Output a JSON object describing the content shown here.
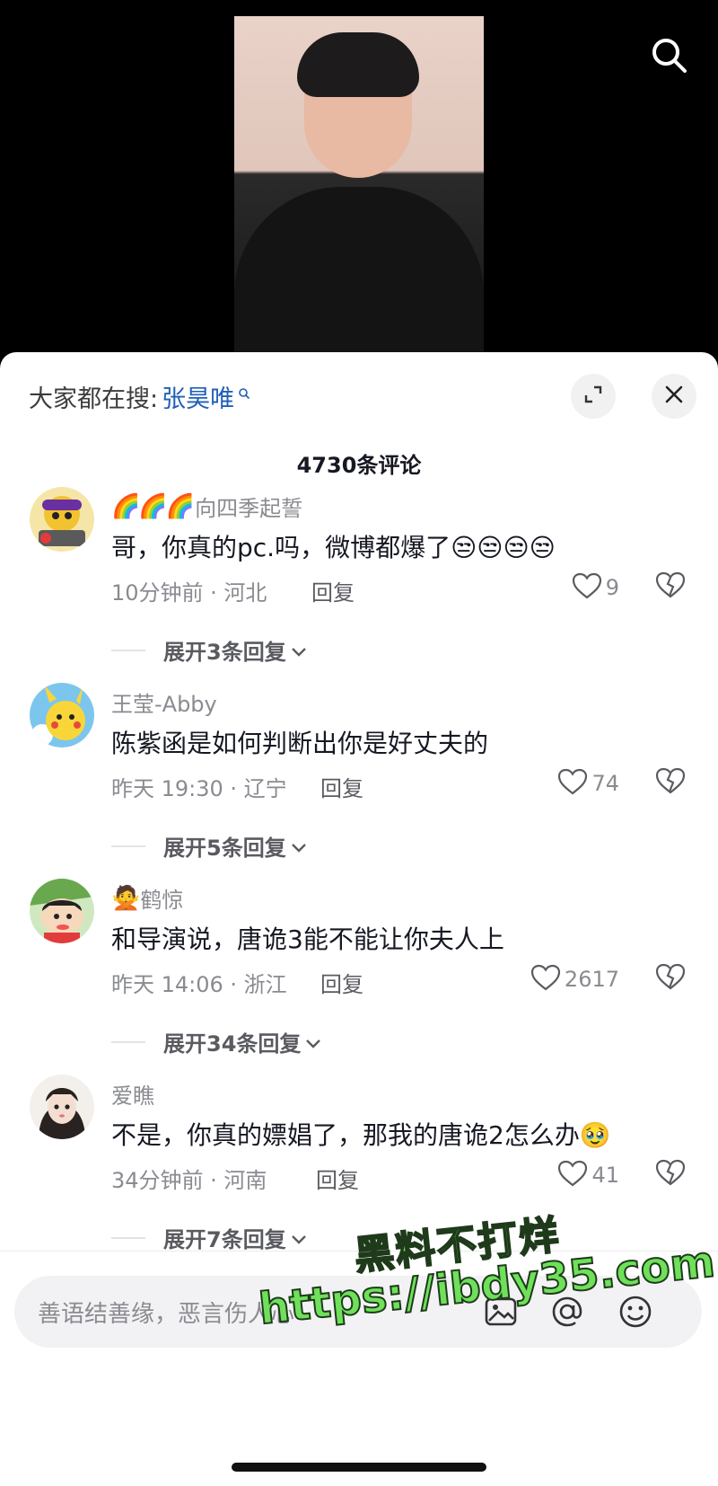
{
  "video": {
    "search_icon": "search-icon"
  },
  "sheet": {
    "hot_search_prefix": "大家都在搜:",
    "hot_search_keyword": "张昊唯",
    "comment_count_title": "4730条评论"
  },
  "comments": [
    {
      "badges": "🌈🌈🌈",
      "username": "向四季起誓",
      "text": "哥，你真的pc.吗，微博都爆了😒😒😒😒",
      "meta": "10分钟前 · 河北",
      "reply": "回复",
      "likes": "9",
      "expand": "展开3条回复"
    },
    {
      "badges": "",
      "username": "王莹-Abby",
      "text": "陈紫函是如何判断出你是好丈夫的",
      "meta": "昨天 19:30 · 辽宁",
      "reply": "回复",
      "likes": "74",
      "expand": "展开5条回复"
    },
    {
      "badges": "🙅",
      "username": "鹤惊",
      "text": "和导演说，唐诡3能不能让你夫人上",
      "meta": "昨天 14:06 · 浙江",
      "reply": "回复",
      "likes": "2617",
      "expand": "展开34条回复"
    },
    {
      "badges": "",
      "username": "爱瞧",
      "text": "不是，你真的嫖娼了，那我的唐诡2怎么办🥹",
      "meta": "34分钟前 · 河南",
      "reply": "回复",
      "likes": "41",
      "expand": "展开7条回复"
    }
  ],
  "input": {
    "placeholder": "善语结善缘，恶言伤人心"
  },
  "watermark": {
    "line1": "黑料不打烊",
    "line2": "https://ibdy35.com"
  },
  "colors": {
    "link": "#1f5fb7",
    "watermark": "#6ee05a"
  }
}
